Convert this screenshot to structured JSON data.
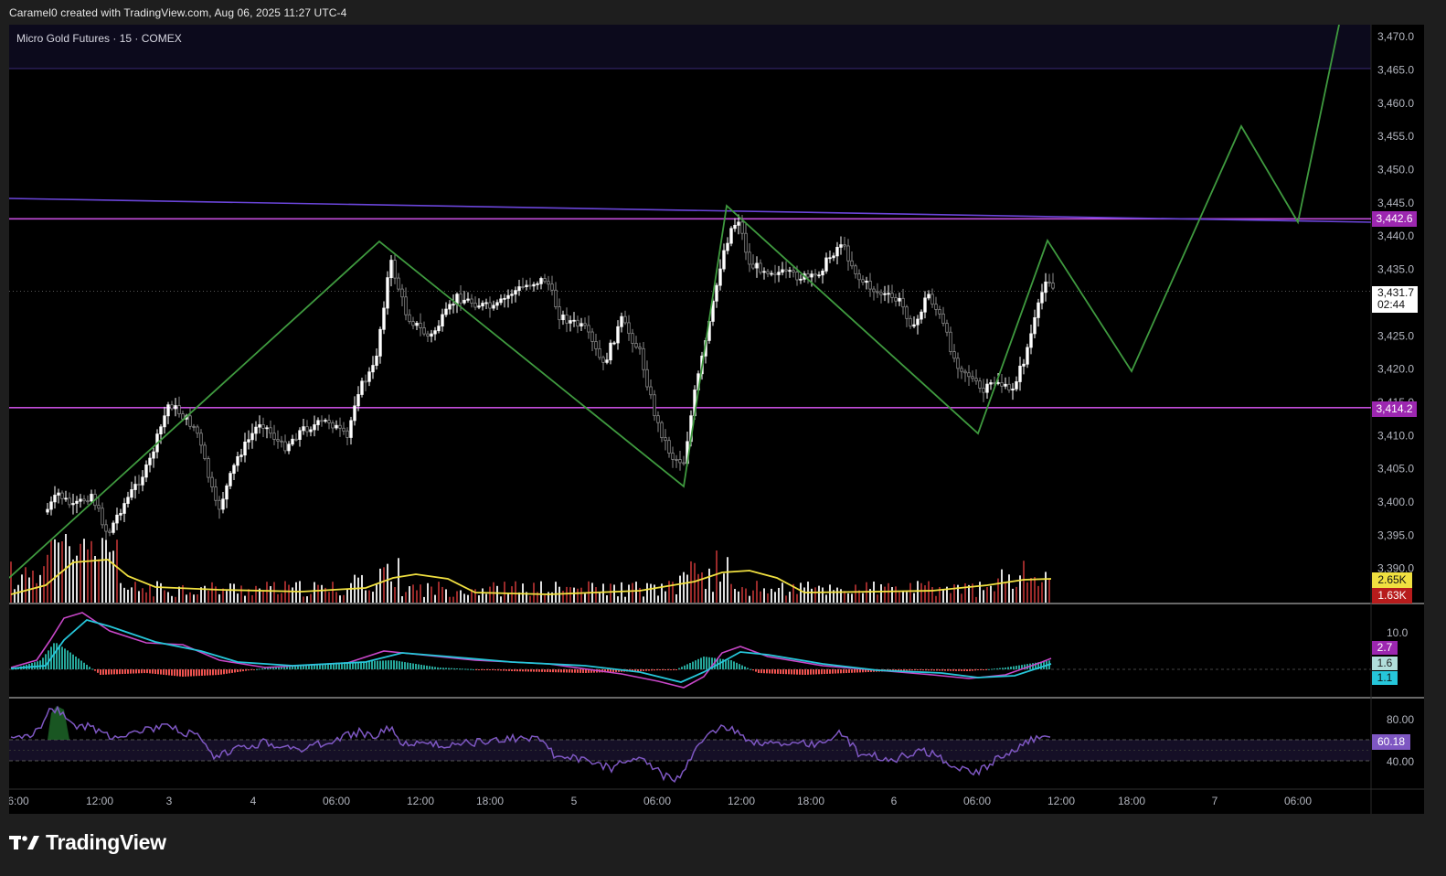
{
  "header": {
    "attribution": "Caramel0 created with TradingView.com, Aug 06, 2025 11:27 UTC-4"
  },
  "symbol": {
    "title": "Micro Gold Futures · 15 · COMEX"
  },
  "colors": {
    "background": "#000000",
    "frame": "#1e1e1e",
    "up_candle": "#ffffff",
    "down_candle": "#8a8a8a",
    "zigzag": "#3f9a3f",
    "resistance": "#c44ddb",
    "trendline": "#6a45d9",
    "volume_ma": "#f0e040",
    "macd": "#c847c8",
    "signal": "#26c6da",
    "rsi": "#7e57c2"
  },
  "price_axis": {
    "ticks": [
      "3,470.0",
      "3,465.0",
      "3,460.0",
      "3,455.0",
      "3,450.0",
      "3,445.0",
      "3,440.0",
      "3,435.0",
      "3,425.0",
      "3,420.0",
      "3,415.0",
      "3,410.0",
      "3,405.0",
      "3,400.0",
      "3,395.0",
      "3,390.0"
    ],
    "upper_level_label": "3,442.6",
    "lower_level_label": "3,414.2",
    "last_price": "3,431.7",
    "countdown": "02:44",
    "volume_ma_label": "2.65K",
    "volume_label": "1.63K"
  },
  "time_axis": {
    "ticks": [
      "6:00",
      "12:00",
      "3",
      "4",
      "06:00",
      "12:00",
      "18:00",
      "5",
      "06:00",
      "12:00",
      "18:00",
      "6",
      "06:00",
      "12:00",
      "18:00",
      "7",
      "06:00"
    ]
  },
  "macd_pane": {
    "scale_label": "10.0",
    "macd_value": "2.7",
    "hist_value": "1.6",
    "signal_value": "1.1"
  },
  "rsi_pane": {
    "upper_label": "80.00",
    "lower_label": "40.00",
    "value": "60.18"
  },
  "footer": {
    "brand": "TradingView",
    "logo_icon": "tradingview-logo-icon"
  },
  "chart_data": {
    "type": "line",
    "series": [
      {
        "name": "",
        "kind": "candlestick-approx",
        "x": [
          "Aug 1 06:00",
          "Aug 1 12:00",
          "Aug 3",
          "Aug 4",
          "Aug 4 06:00",
          "Aug 4 12:00",
          "Aug 4 18:00",
          "Aug 5",
          "Aug 5 06:00",
          "Aug 5 12:00",
          "Aug 5 18:00",
          "Aug 6",
          "Aug 6 06:00",
          "Aug 6 11:27"
        ],
        "close": [
          3396.0,
          3400.0,
          3410.0,
          3407.0,
          3412.0,
          3428.0,
          3430.0,
          3432.0,
          3404.0,
          3437.0,
          3436.0,
          3430.0,
          3418.0,
          3431.7
        ]
      },
      {
        "name": "",
        "kind": "projection-zigzag",
        "x": [
          "Aug 1 06:00",
          "Aug 4 09:00",
          "Aug 5 08:00",
          "Aug 5 10:30",
          "Aug 6 06:00",
          "Aug 6 09:00",
          "Aug 6 15:00",
          "Aug 7 09:00",
          "Aug 7 03:00",
          "Aug 7 08:00"
        ],
        "y": [
          3388.0,
          3439.5,
          3403.0,
          3445.0,
          3411.0,
          3439.5,
          3420.0,
          3442.0,
          3456.5,
          3470.0
        ]
      }
    ],
    "levels": [
      3442.6,
      3414.2
    ],
    "ylim": [
      3388,
      3471
    ],
    "grid": false,
    "legend": "none"
  }
}
